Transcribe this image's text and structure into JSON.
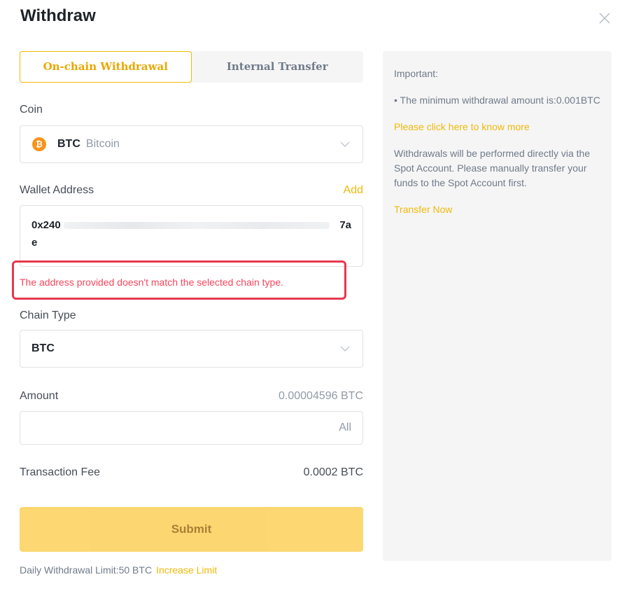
{
  "header": {
    "title": "Withdraw"
  },
  "tabs": [
    {
      "label": "On-chain Withdrawal",
      "active": true
    },
    {
      "label": "Internal Transfer",
      "active": false
    }
  ],
  "coin": {
    "label": "Coin",
    "symbol": "BTC",
    "name": "Bitcoin",
    "icon_glyph": "₿"
  },
  "wallet": {
    "label": "Wallet Address",
    "add_label": "Add",
    "address_start": "0x240",
    "address_end": "7a",
    "address_wrap": "e",
    "error": "The address provided doesn't match the selected chain type."
  },
  "chain": {
    "label": "Chain Type",
    "value": "BTC"
  },
  "amount": {
    "label": "Amount",
    "available": "0.00004596 BTC",
    "value": "",
    "all_label": "All"
  },
  "fee": {
    "label": "Transaction Fee",
    "value": "0.0002 BTC"
  },
  "submit": {
    "label": "Submit"
  },
  "limit": {
    "text": "Daily Withdrawal Limit:50 BTC",
    "link": "Increase Limit"
  },
  "info": {
    "heading": "Important:",
    "min_text": "• The minimum withdrawal amount is:0.001BTC",
    "know_more": "Please click here to know more",
    "spot_text": "Withdrawals will be performed directly via the Spot Account. Please manually transfer your funds to the Spot Account first.",
    "transfer_now": "Transfer Now"
  },
  "colors": {
    "accent": "#f0b90b",
    "error": "#f6465d",
    "submit_bg": "#fcd56a",
    "panel_bg": "#f5f5f5"
  }
}
